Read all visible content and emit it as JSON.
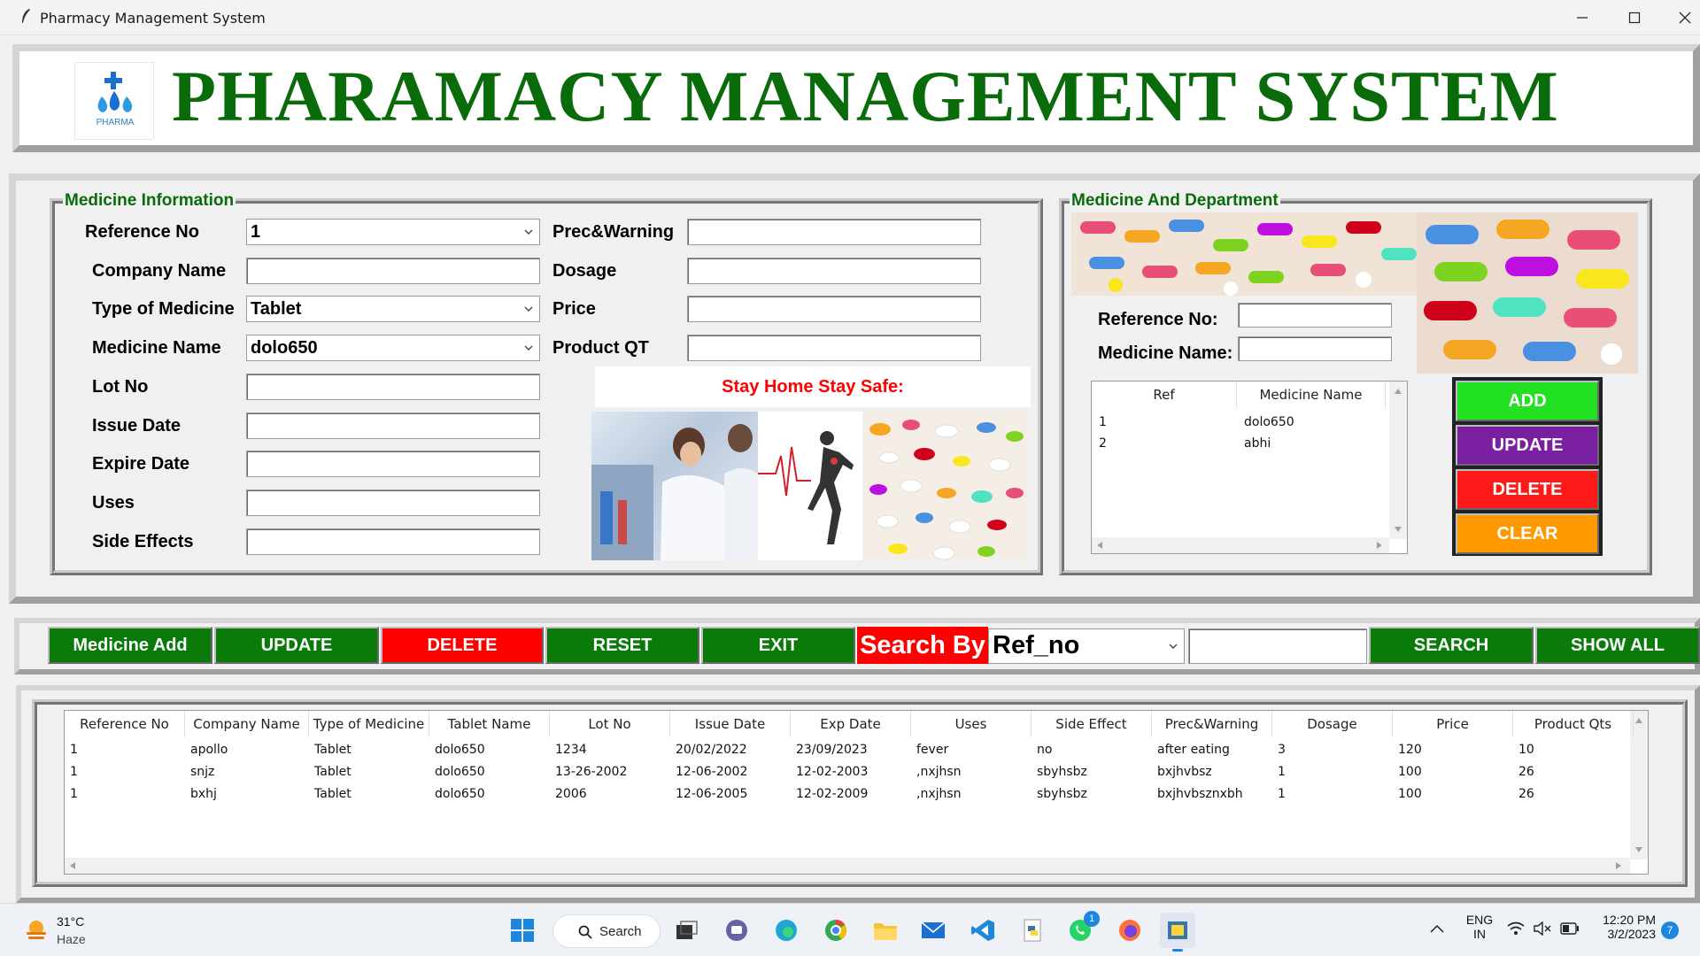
{
  "window": {
    "title": "Pharmacy Management System"
  },
  "header": {
    "title": "PHARAMACY MANAGEMENT SYSTEM",
    "logo_text": "PHARMA"
  },
  "medicine_info": {
    "group_title": "Medicine Information",
    "labels": {
      "reference_no": "Reference No",
      "company_name": "Company Name",
      "type_of_medicine": "Type of Medicine",
      "medicine_name": "Medicine Name",
      "lot_no": "Lot No",
      "issue_date": "Issue Date",
      "expire_date": "Expire Date",
      "uses": "Uses",
      "side_effects": "Side Effects",
      "prec_warning": "Prec&Warning",
      "dosage": "Dosage",
      "price": "Price",
      "product_qt": "Product QT"
    },
    "values": {
      "reference_no": "1",
      "type_of_medicine": "Tablet",
      "medicine_name": "dolo650"
    },
    "banner_text": "Stay Home Stay Safe:"
  },
  "department": {
    "group_title": "Medicine And Department",
    "labels": {
      "reference_no": "Reference No:",
      "medicine_name": "Medicine Name:"
    },
    "table": {
      "columns": [
        "Ref",
        "Medicine Name"
      ],
      "rows": [
        [
          "1",
          "dolo650"
        ],
        [
          "2",
          "abhi"
        ]
      ]
    },
    "buttons": {
      "add": "ADD",
      "update": "UPDATE",
      "delete": "DELETE",
      "clear": "CLEAR"
    }
  },
  "toolbar": {
    "medicine_add": "Medicine Add",
    "update": "UPDATE",
    "delete": "DELETE",
    "reset": "RESET",
    "exit": "EXIT",
    "search_by_label": "Search By",
    "search_by_value": "Ref_no",
    "search": "SEARCH",
    "show_all": "SHOW ALL"
  },
  "records": {
    "columns": [
      "Reference No",
      "Company Name",
      "Type of Medicine",
      "Tablet Name",
      "Lot No",
      "Issue Date",
      "Exp Date",
      "Uses",
      "Side Effect",
      "Prec&Warning",
      "Dosage",
      "Price",
      "Product Qts"
    ],
    "rows": [
      [
        "1",
        "apollo",
        "Tablet",
        "dolo650",
        "1234",
        "20/02/2022",
        "23/09/2023",
        "fever",
        "no",
        "after eating",
        "3",
        "120",
        "10"
      ],
      [
        "1",
        "snjz",
        "Tablet",
        "dolo650",
        "13-26-2002",
        "12-06-2002",
        "12-02-2003",
        ",nxjhsn",
        "sbyhsbz",
        "bxjhvbsz",
        "1",
        "100",
        "26"
      ],
      [
        "1",
        "bxhj",
        "Tablet",
        "dolo650",
        "2006",
        "12-06-2005",
        "12-02-2009",
        ",nxjhsn",
        "sbyhsbz",
        "bxjhvbsznxbh",
        "1",
        "100",
        "26"
      ]
    ]
  },
  "taskbar": {
    "weather_temp": "31°C",
    "weather_desc": "Haze",
    "search_label": "Search",
    "lang_top": "ENG",
    "lang_bottom": "IN",
    "time": "12:20 PM",
    "date": "3/2/2023",
    "notification_count": "7",
    "whatsapp_badge": "1"
  },
  "colors": {
    "title_green": "#0a6b0a",
    "button_green": "#0a7a0a",
    "button_red": "#ff0000",
    "add_green": "#22e022",
    "update_purple": "#7a1fa0",
    "clear_orange": "#ff9900"
  }
}
